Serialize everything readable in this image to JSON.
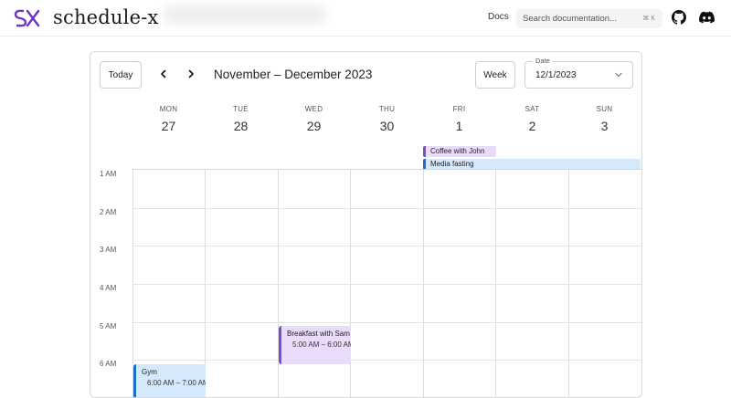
{
  "nav": {
    "brand": "schedule-x",
    "docs_label": "Docs",
    "search_placeholder": "Search documentation...",
    "search_shortcut": "⌘ K",
    "icons": [
      "logo-icon",
      "github-icon",
      "discord-icon"
    ]
  },
  "toolbar": {
    "today_label": "Today",
    "range_label": "November – December 2023",
    "view_label": "Week",
    "date_field_label": "Date",
    "date_value": "12/1/2023"
  },
  "days": [
    {
      "name": "MON",
      "num": "27"
    },
    {
      "name": "TUE",
      "num": "28"
    },
    {
      "name": "WED",
      "num": "29"
    },
    {
      "name": "THU",
      "num": "30"
    },
    {
      "name": "FRI",
      "num": "1"
    },
    {
      "name": "SAT",
      "num": "2"
    },
    {
      "name": "SUN",
      "num": "3"
    }
  ],
  "hours": [
    "1 AM",
    "2 AM",
    "3 AM",
    "4 AM",
    "5 AM",
    "6 AM"
  ],
  "allday_events": [
    {
      "title": "Coffee with John"
    },
    {
      "title": "Media fasting"
    }
  ],
  "timed_events": [
    {
      "title": "Breakfast with Sam",
      "time": "5:00 AM – 6:00 AM"
    },
    {
      "title": "Gym",
      "time": "6:00 AM – 7:00 AM"
    }
  ],
  "colors": {
    "purple_bg": "#e9dcfb",
    "purple_border": "#7c4dcb",
    "blue_bg": "#d6e8fb",
    "blue_border": "#1d6fc9"
  }
}
